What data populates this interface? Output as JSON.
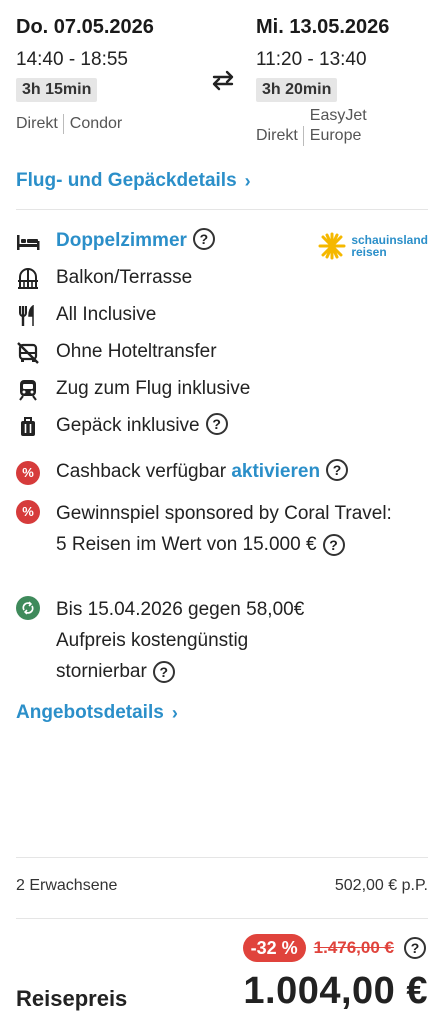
{
  "outbound": {
    "date": "Do. 07.05.2026",
    "times": "14:40 - 18:55",
    "duration": "3h 15min",
    "type": "Direkt",
    "airline": "Condor"
  },
  "return": {
    "date": "Mi. 13.05.2026",
    "times": "11:20 - 13:40",
    "duration": "3h 20min",
    "type": "Direkt",
    "airline_line1": "EasyJet",
    "airline_line2": "Europe"
  },
  "flight_details_link": "Flug- und Gepäckdetails",
  "tour_operator": {
    "name_line1": "schauinsland",
    "name_line2": "reisen"
  },
  "features": {
    "room": "Doppelzimmer",
    "balcony": "Balkon/Terrasse",
    "board": "All Inclusive",
    "transfer": "Ohne Hoteltransfer",
    "train": "Zug zum Flug inklusive",
    "luggage": "Gepäck inklusive",
    "cashback_text": "Cashback verfügbar",
    "cashback_action": "aktivieren",
    "raffle": "Gewinnspiel sponsored by Coral Travel: 5 Reisen im Wert von 15.000 €",
    "cancellation_line1": "Bis 15.04.2026 gegen 58,00€",
    "cancellation_line2": "Aufpreis kostengünstig",
    "cancellation_line3": "stornierbar",
    "percent_symbol": "%",
    "help_symbol": "?"
  },
  "offer_details_link": "Angebotsdetails",
  "chevron": "›",
  "price": {
    "travellers": "2 Erwachsene",
    "per_person": "502,00 € p.P.",
    "discount": "-32 %",
    "old_price": "1.476,00 €",
    "total_label": "Reisepreis",
    "total": "1.004,00 €"
  },
  "colors": {
    "accent": "#2b8fc9",
    "discount": "#e0433c",
    "storno": "#3f8a5b",
    "logo_sun": "#f5b800"
  }
}
